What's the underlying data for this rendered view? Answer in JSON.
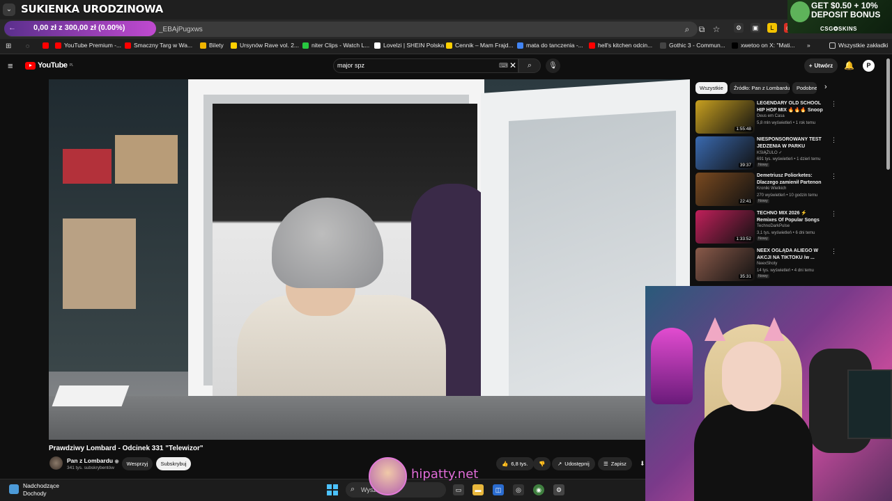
{
  "stream": {
    "title": "SUKIENKA URODZINOWA"
  },
  "donation": {
    "back": "←",
    "text": "0,00 zł z 300,00 zł (0.00%)"
  },
  "browser": {
    "url_fragment": "_EBAjPugxws",
    "bookmarks": [
      {
        "label": "YouTube Premium -...",
        "color": "#ff0000"
      },
      {
        "label": "Smaczny Targ w Wa...",
        "color": "#ff0000"
      },
      {
        "label": "Bilety",
        "color": "#f0b400"
      },
      {
        "label": "Ursynów Rave vol. 2...",
        "color": "#ffd000"
      },
      {
        "label": "niter Clips - Watch L...",
        "color": "#28c840"
      },
      {
        "label": "Lovelzi | SHEIN Polska",
        "color": "#ffffff"
      },
      {
        "label": "Cennik – Mam Frajd...",
        "color": "#ffd000"
      },
      {
        "label": "mata do tanczenia -...",
        "color": "#4285f4"
      },
      {
        "label": "hell's kitchen odcin...",
        "color": "#ff0000"
      },
      {
        "label": "Gothic 3 - Commun...",
        "color": "#444444"
      },
      {
        "label": "xwetoo on X: \"Mati...",
        "color": "#000000"
      }
    ],
    "all_bookmarks": "Wszystkie zakładki",
    "more": "»"
  },
  "promo": {
    "line1": "GET $0.50 + 10%",
    "line2": "DEPOSIT BONUS",
    "brand": "CSG✪SKINS"
  },
  "youtube": {
    "logo": "YouTube",
    "region": "PL",
    "search_value": "major spz",
    "create_label": "Utwórz",
    "avatar_letter": "P"
  },
  "video": {
    "title": "Prawdziwy Lombard - Odcinek 331 \"Telewizor\"",
    "channel": "Pan z Lombardu",
    "subscribers": "341 tys. subskrybentów",
    "support_label": "Wesprzyj",
    "subscribe_label": "Subskrybuj",
    "likes": "6,8 tys.",
    "share_label": "Udostępnij",
    "save_label": "Zapisz"
  },
  "chips": [
    "Wszystkie",
    "Źródło: Pan z Lombardu",
    "Podobne"
  ],
  "recommendations": [
    {
      "title": "LEGENDARY OLD SCHOOL HIP HOP MIX 🔥🔥🔥 Snoop Dog...",
      "channel": "Deus em Casa",
      "meta": "5,8 mln wyświetleń • 1 rok temu",
      "duration": "1:55:48",
      "badge": "",
      "thumb_color": "#c8a020"
    },
    {
      "title": "NIESPONSOROWANY TEST JEDZENIA W PARKU ROZRYWKI",
      "channel": "KSIĄŻULO ✓",
      "meta": "691 tys. wyświetleń • 1 dzień temu",
      "duration": "39:37",
      "badge": "Nowy",
      "thumb_color": "#3a6ab0"
    },
    {
      "title": "Demetriusz Poliorketes: Dlaczego zamienił Partenon w...",
      "channel": "Kroniki Wielkich",
      "meta": "270 wyświetleń • 10 godzin temu",
      "duration": "22:41",
      "badge": "Nowy",
      "thumb_color": "#7a4a20"
    },
    {
      "title": "TECHNO MIX 2026 ⚡ Remixes Of Popular Songs ⚡ Techno ...",
      "channel": "TechnoDarkPulse",
      "meta": "3,1 tys. wyświetleń • 6 dni temu",
      "duration": "1:33:52",
      "badge": "Nowy",
      "thumb_color": "#c0205a"
    },
    {
      "title": "NEEX OGLĄDA ALIEGO W AKCJI NA TIKTOKU /w ...",
      "channel": "NeexShoty",
      "meta": "14 tys. wyświetleń • 4 dni temu",
      "duration": "35:31",
      "badge": "Nowy",
      "thumb_color": "#8a5a4a"
    }
  ],
  "overlay": {
    "name": "hipatty.net"
  },
  "taskbar": {
    "weather_title": "Nadchodzące",
    "weather_sub": "Dochody",
    "search_placeholder": "Wyszukaj"
  }
}
